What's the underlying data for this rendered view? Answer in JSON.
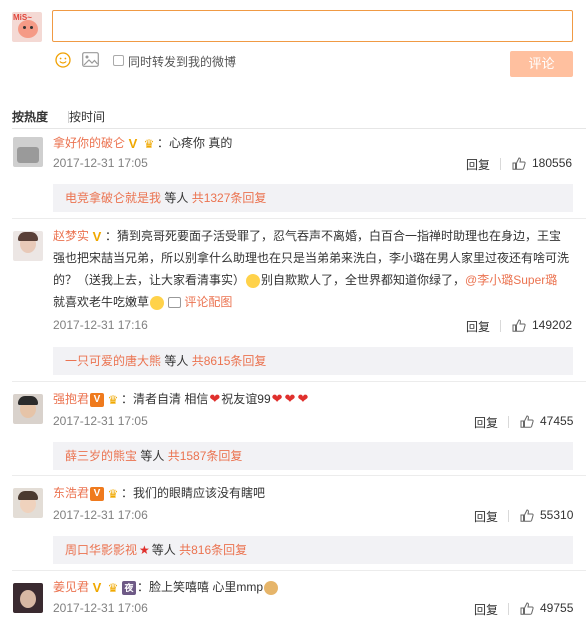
{
  "composer": {
    "repost_label": "同时转发到我的微博",
    "submit_label": "评论",
    "input_value": "",
    "self_avatar_tag": "MiS~"
  },
  "sort": {
    "hot": "按热度",
    "time": "按时间"
  },
  "colors": {
    "accent": "#eb7350",
    "button": "#ffc09f",
    "thread_bg": "#f2f2f5"
  },
  "comments": [
    {
      "user": "拿好你的破仑",
      "text": "：心疼你 真的",
      "time": "2017-12-31 17:05",
      "reply": "回复",
      "likes": "180556",
      "thread": {
        "user": "电竞拿破仑就是我",
        "mid": " 等人 ",
        "count": "共1327条回复"
      }
    },
    {
      "user": "赵梦实",
      "text1": "：猜到亮哥死要面子活受罪了，忍气吞声不离婚，白百合一指禅时助理也在身边，王宝强也把宋喆当兄弟，所以别拿什么助理也在只是当弟弟来洗白，李小璐在男人家里过夜还有啥可洗的？（送我上去，让大家看清事实）",
      "text2": "别自欺欺人了，全世界都知道你绿了，",
      "mention": "@李小璐Super璐",
      "text3": "就喜欢老牛吃嫩草",
      "pic_link": "评论配图",
      "time": "2017-12-31 17:16",
      "reply": "回复",
      "likes": "149202",
      "thread": {
        "user": "一只可爱的唐大熊",
        "mid": " 等人 ",
        "count": "共8615条回复"
      }
    },
    {
      "user": "强抱君",
      "text": "：清者自清 相信",
      "text2": "祝友谊99",
      "time": "2017-12-31 17:05",
      "reply": "回复",
      "likes": "47455",
      "thread": {
        "user": "薛三岁的熊宝",
        "mid": " 等人 ",
        "count": "共1587条回复"
      }
    },
    {
      "user": "东浩君",
      "text": "：我们的眼睛应该没有瞎吧",
      "time": "2017-12-31 17:06",
      "reply": "回复",
      "likes": "55310",
      "thread": {
        "user": "周口华影影视",
        "mid": "等人 ",
        "count": "共816条回复"
      }
    },
    {
      "user": "姜见君",
      "night": "夜",
      "text": "：脸上笑嘻嘻 心里mmp",
      "time": "2017-12-31 17:06",
      "reply": "回复",
      "likes": "49755"
    }
  ]
}
